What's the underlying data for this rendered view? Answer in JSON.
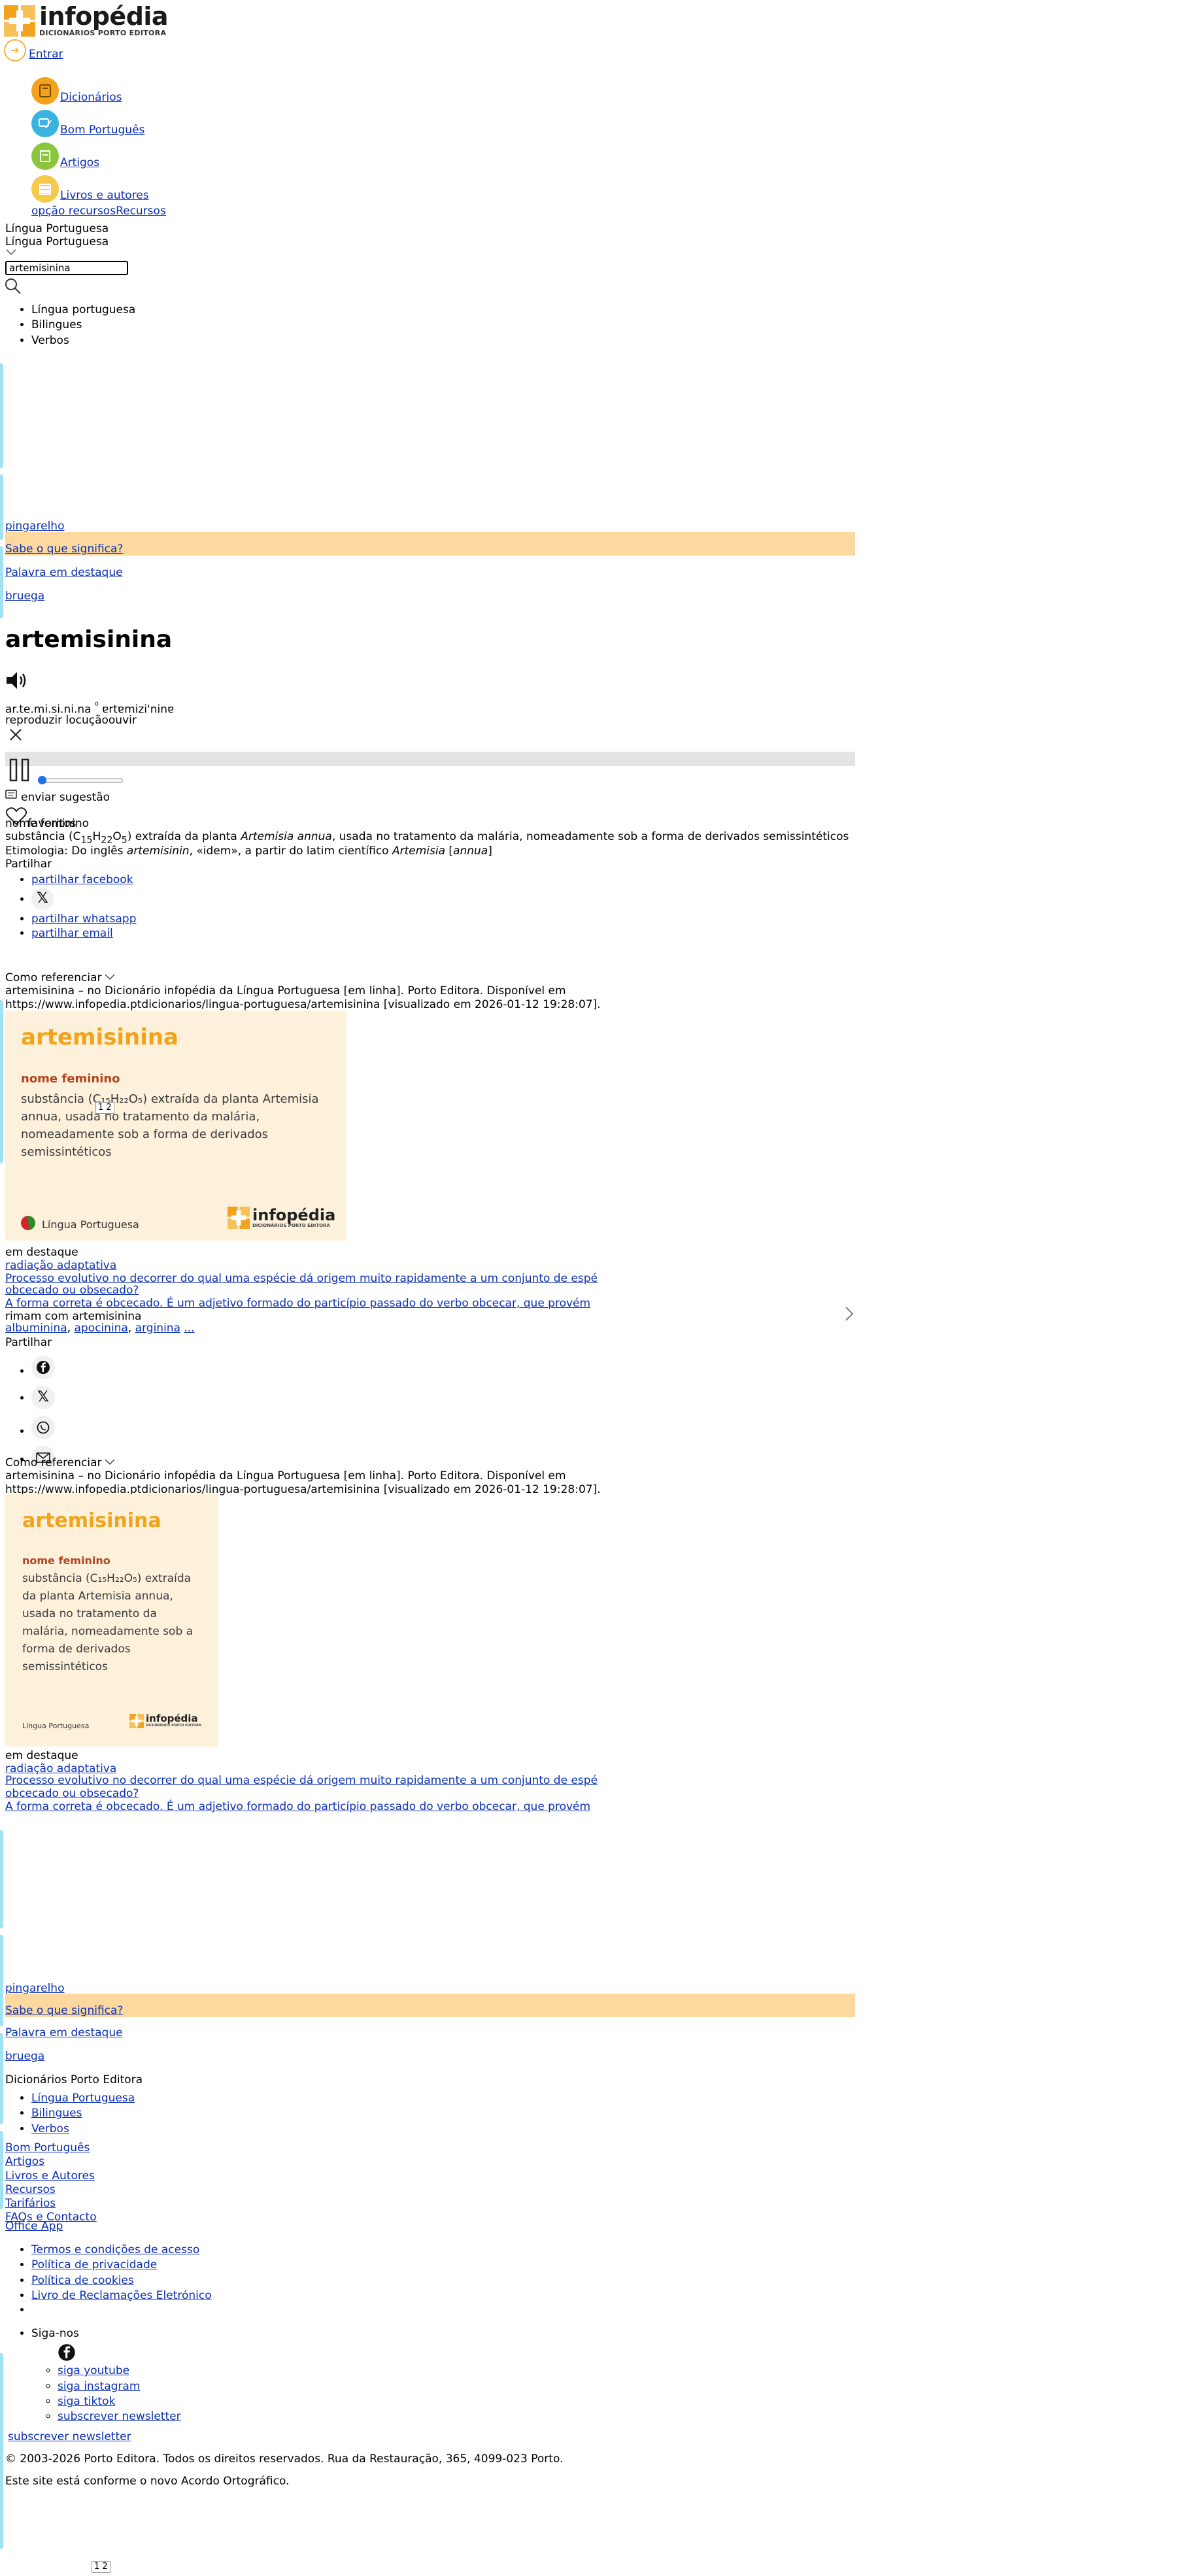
{
  "header": {
    "brand": "infopédia",
    "brand_sub": "DICIONÁRIOS PORTO EDITORA",
    "login": "Entrar"
  },
  "nav": {
    "items": [
      "Dicionários",
      "Bom Português",
      "Artigos",
      "Livros e autores"
    ],
    "resources_alt": "opção recursos",
    "resources": "Recursos"
  },
  "dictionary": {
    "current": "Língua Portuguesa",
    "current_dup": "Língua Portuguesa",
    "options": [
      "Língua portuguesa",
      "Bilingues",
      "Verbos"
    ]
  },
  "search": {
    "value": "artemisinina"
  },
  "featured": {
    "word1": "pingarelho",
    "prompt": "Sabe o que significa?",
    "label": "Palavra em destaque",
    "word2": "bruega"
  },
  "entry": {
    "headword": "artemisinina",
    "syllables": "ar.te.mi.si.ni.na",
    "pron_mark": "⁰",
    "ipa": "ɐrtɐmizi'ninɐ",
    "listen": "reproduzir locuçãoouvir",
    "suggest": "enviar sugestão",
    "favorites": "favoritos",
    "pos": "nome feminino",
    "def_pre": "substância (C",
    "def_sub1": "15",
    "def_h": "H",
    "def_sub2": "22",
    "def_o": "O",
    "def_sub3": "5",
    "def_mid": ") extraída da planta ",
    "def_species": "Artemisia annua",
    "def_post": ", usada no tratamento da malária, nomeadamente sob a forma de derivados semissintéticos",
    "etym_pre": "Etimologia: Do inglês ",
    "etym_word": "artemisinin",
    "etym_mid": ", «idem», a partir do latim científico ",
    "etym_genus": "Artemisia",
    "etym_bracket_open": " [",
    "etym_annua": "annua",
    "etym_bracket_close": "]"
  },
  "share": {
    "label": "Partilhar",
    "facebook": "partilhar facebook",
    "whatsapp": "partilhar whatsapp",
    "email": "partilhar email"
  },
  "cite": {
    "label": "Como referenciar",
    "text": "artemisinina – no Dicionário infopédia da Língua Portuguesa [em linha]. Porto Editora. Disponível em https://www.infopedia.ptdicionarios/lingua-portuguesa/artemisinina [visualizado em 2026-01-12 19:28:07]."
  },
  "card": {
    "title": "artemisinina",
    "pos": "nome feminino",
    "def": "substância (C₁₅H₂₂O₅) extraída da planta Artemisia annua, usada no tratamento da malária, nomeadamente sob a forma de derivados semissintéticos",
    "lang": "Língua Portuguesa",
    "brand": "infopédia",
    "brand_sub": "DICIONÁRIOS PORTO EDITORA",
    "pager": "1 2"
  },
  "highlights": {
    "label": "em destaque",
    "items": [
      "radiação adaptativa",
      "Processo evolutivo no decorrer do qual uma espécie dá origem muito rapidamente a um conjunto de espé",
      "obcecado ou obsecado?",
      "A forma correta é obcecado. É um adjetivo formado do particípio passado do verbo obcecar, que provém"
    ]
  },
  "rhymes": {
    "label": "rimam com artemisinina",
    "words": [
      "albuminina",
      "apocinina",
      "arginina"
    ],
    "more": "..."
  },
  "footer": {
    "title": "Dicionários Porto Editora",
    "dicts": [
      "Língua Portuguesa",
      "Bilingues",
      "Verbos"
    ],
    "links": [
      "Bom Português",
      "Artigos",
      "Livros e Autores",
      "Recursos",
      "Tarifários",
      "FAQs e Contacto"
    ],
    "office": "Office App",
    "legal": [
      "Termos e condições de acesso",
      "Política de privacidade",
      "Política de cookies",
      "Livro de Reclamações Eletrónico"
    ],
    "follow": "Siga-nos",
    "social": [
      "siga youtube",
      "siga instagram",
      "siga tiktok"
    ],
    "subscribe": "subscrever newsletter",
    "copyright": "© 2003-2026 Porto Editora. Todos os direitos reservados. Rua da Restauração, 365, 4099-023 Porto.",
    "ao": "Este site está conforme o novo Acordo Ortográfico.",
    "pager": "1 2"
  },
  "colors": {
    "brand_orange": "#f2a31b",
    "highlight_bar": "#fdd9a0",
    "card_bg": "#fdf1dc",
    "side_tab": "#9fe3f2",
    "link": "#0b2fb3"
  }
}
